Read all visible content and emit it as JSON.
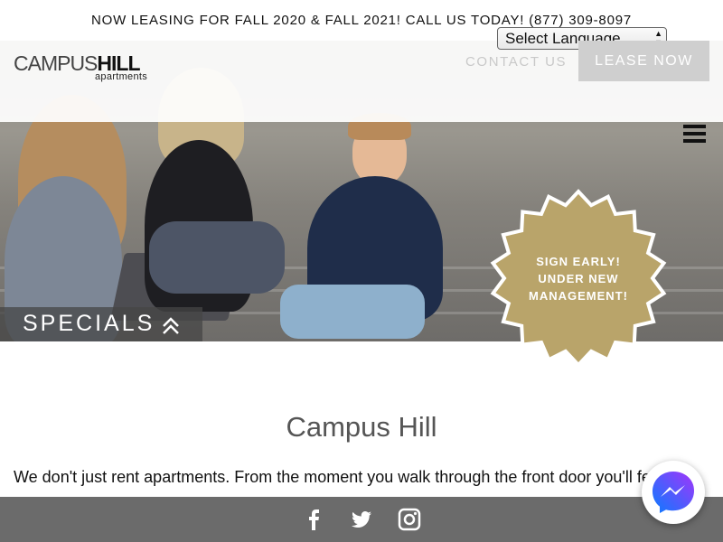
{
  "announcement": "NOW LEASING FOR FALL 2020 & FALL 2021! CALL US TODAY! (877) 309-8097",
  "logo": {
    "word_thin": "CAMPUS",
    "word_bold": "HILL",
    "sub": "apartments"
  },
  "language_select": {
    "selected": "Select Language"
  },
  "nav": {
    "contact": "CONTACT US",
    "lease": "LEASE NOW"
  },
  "hero": {
    "specials_label": "SPECIALS",
    "badge_text": [
      "SIGN EARLY!",
      "UNDER NEW",
      "MANAGEMENT!"
    ],
    "badge_color": "#b9a46a"
  },
  "main": {
    "title": "Campus Hill",
    "intro": "We don't just rent apartments. From the moment you walk through the front door you'll feel"
  },
  "footer": {
    "background": "#6b6b6b",
    "social_icons": [
      "facebook-icon",
      "twitter-icon",
      "instagram-icon"
    ]
  },
  "chat_widget": {
    "icon": "messenger-icon"
  }
}
